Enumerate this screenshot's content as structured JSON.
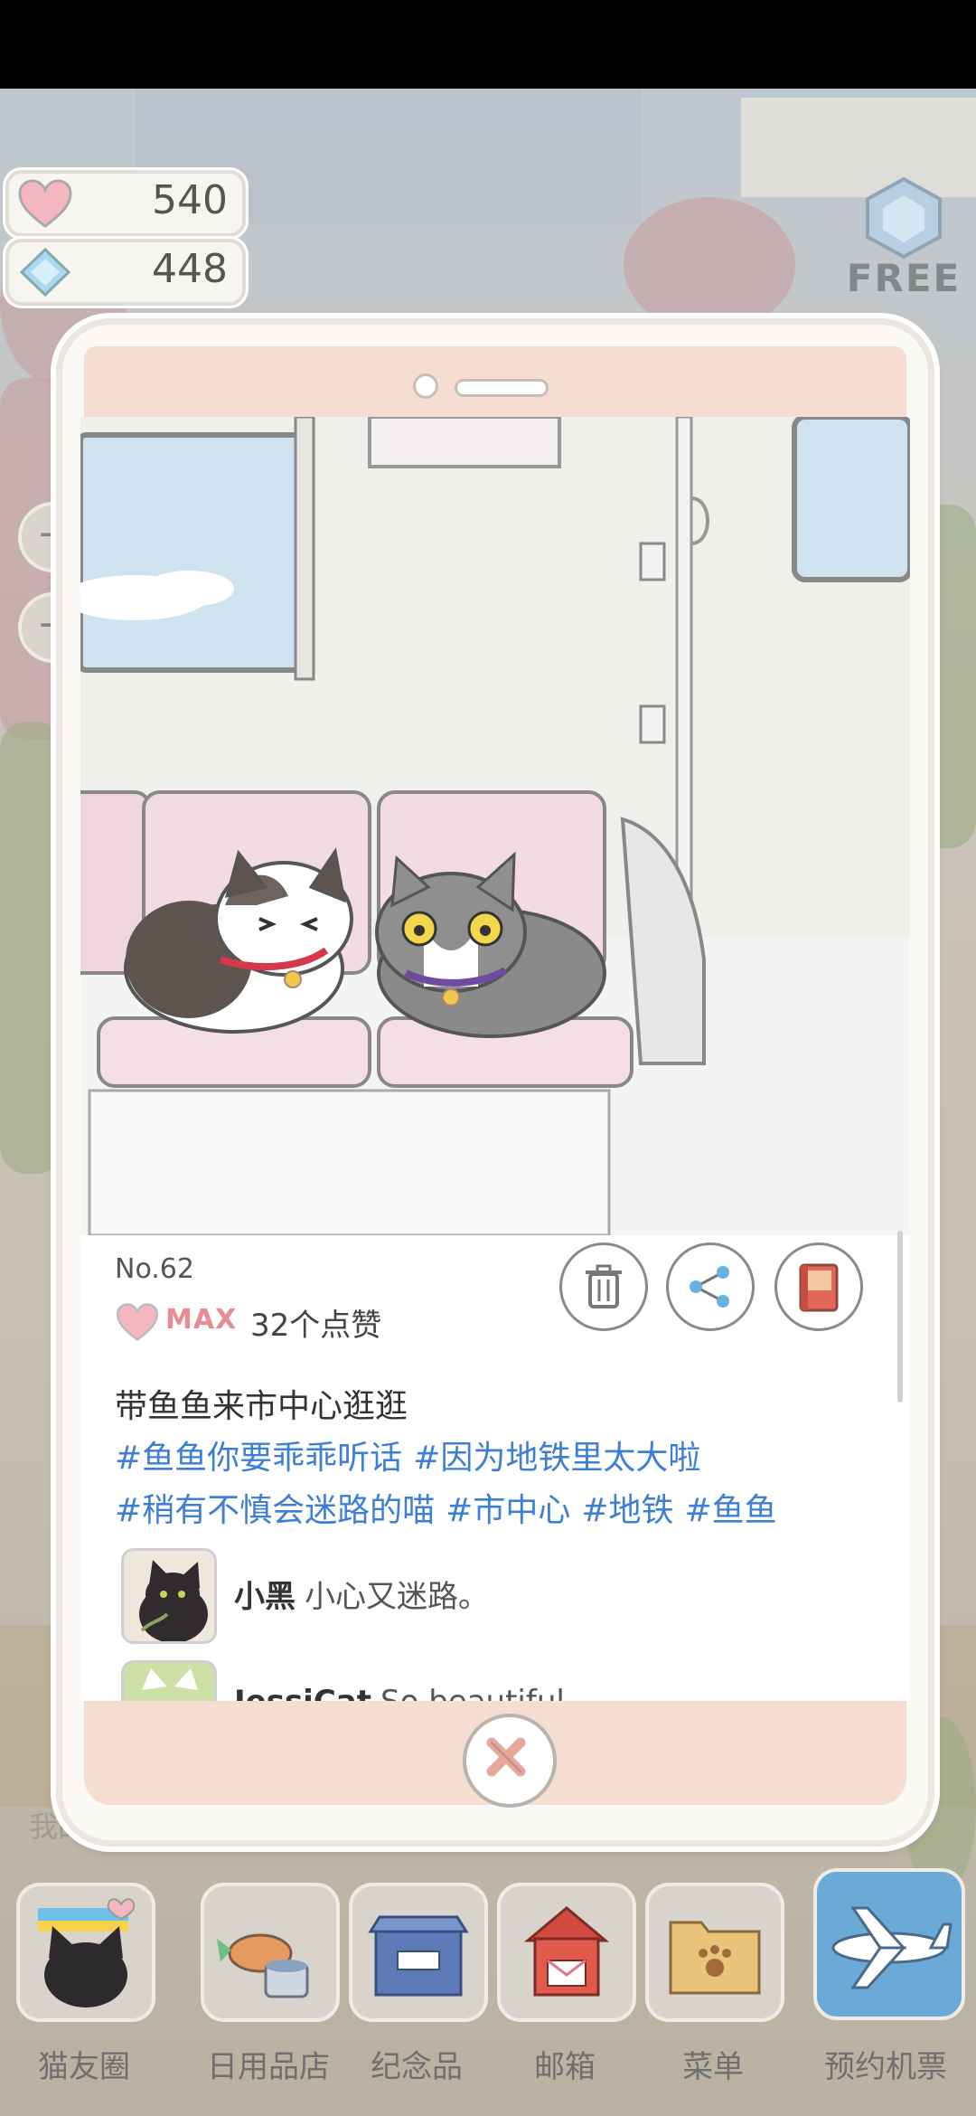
{
  "hud": {
    "hearts": "540",
    "gems": "448",
    "free_label": "FREE"
  },
  "post": {
    "number": "No.62",
    "like_level": "MAX",
    "like_count": "32个点赞",
    "caption": "带鱼鱼来市中心逛逛",
    "tags": [
      "#鱼鱼你要乖乖听话",
      "#因为地铁里太大啦",
      "#稍有不慎会迷路的喵",
      "#市中心",
      "#地铁",
      "#鱼鱼"
    ],
    "comments": [
      {
        "user": "小黑",
        "text": "小心又迷路。"
      },
      {
        "user": "JessiCat",
        "text": "So beautiful"
      }
    ]
  },
  "side_label": "我的房",
  "dock": [
    {
      "label": "猫友圈"
    },
    {
      "label": "日用品店"
    },
    {
      "label": "纪念品"
    },
    {
      "label": "邮箱"
    },
    {
      "label": "菜单"
    },
    {
      "label": "预约机票"
    }
  ],
  "colors": {
    "accent_pink": "#f5ddd2",
    "tag_blue": "#3e7fd6",
    "max_pink": "#e98b93"
  }
}
